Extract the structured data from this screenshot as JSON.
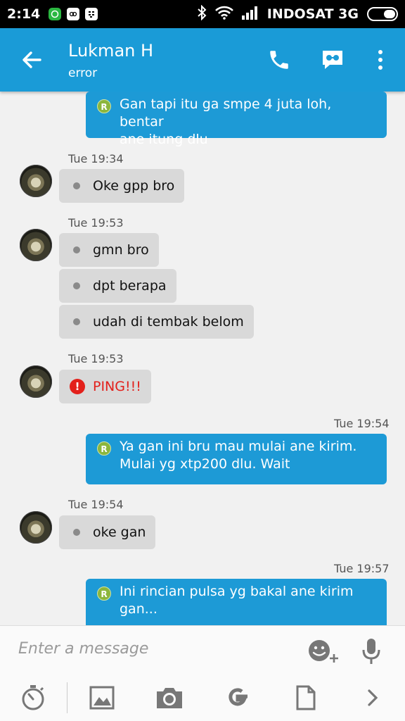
{
  "status_bar": {
    "time": "2:14",
    "carrier": "INDOSAT 3G"
  },
  "app_bar": {
    "title": "Lukman H",
    "subtitle": "error"
  },
  "messages": [
    {
      "type": "outgoing",
      "text_lines": [
        "Gan tapi itu ga smpe 4 juta loh, bentar",
        "ane itung dlu"
      ]
    },
    {
      "type": "timestamp",
      "text": "Tue 19:34"
    },
    {
      "type": "incoming",
      "text": "Oke gpp bro"
    },
    {
      "type": "timestamp",
      "text": "Tue 19:53"
    },
    {
      "type": "incoming",
      "text": "gmn bro"
    },
    {
      "type": "incoming",
      "text": "dpt berapa"
    },
    {
      "type": "incoming",
      "text": "udah di tembak belom"
    },
    {
      "type": "timestamp",
      "text": "Tue 19:53"
    },
    {
      "type": "ping",
      "text": "PING!!!"
    },
    {
      "type": "timestamp",
      "text": "Tue 19:54"
    },
    {
      "type": "outgoing",
      "text_lines": [
        "Ya gan ini bru mau mulai ane kirim.",
        "Mulai yg xtp200 dlu. Wait"
      ]
    },
    {
      "type": "timestamp",
      "text": "Tue 19:54"
    },
    {
      "type": "incoming",
      "text": "oke gan"
    },
    {
      "type": "timestamp",
      "text": "Tue 19:57"
    },
    {
      "type": "outgoing",
      "text_lines": [
        "Ini rincian pulsa yg bakal ane kirim",
        "gan..."
      ]
    }
  ],
  "read_marker": "R",
  "composer": {
    "placeholder": "Enter a message"
  },
  "colors": {
    "accent": "#1a9bd7",
    "outgoing_bubble": "#1d9ad6",
    "incoming_bubble": "#d9d9d9",
    "ping": "#e3201b"
  }
}
